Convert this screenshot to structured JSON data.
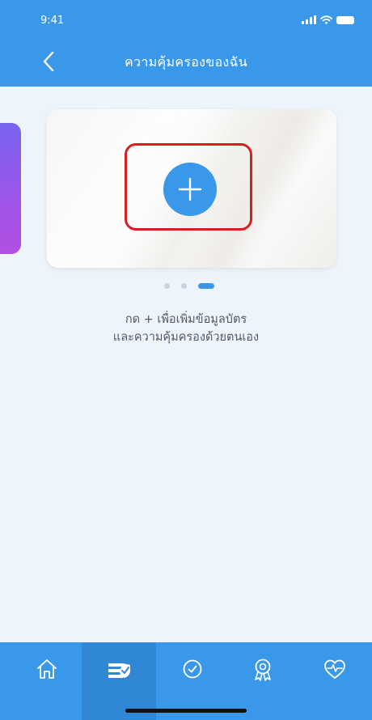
{
  "status_bar": {
    "time": "9:41",
    "icons": [
      "signal-icon",
      "wifi-icon",
      "battery-icon"
    ]
  },
  "header": {
    "title": "ความคุ้มครองของฉัน",
    "back_icon": "chevron-left-icon"
  },
  "carousel": {
    "add_icon": "plus-icon",
    "page_count": 3,
    "active_page": 3
  },
  "hint": {
    "line1": "กด + เพื่อเพิ่มข้อมูลบัตร",
    "line2": "และความคุ้มครองด้วยตนเอง"
  },
  "tabbar": {
    "items": [
      {
        "icon": "home-icon",
        "active": false
      },
      {
        "icon": "coverage-card-icon",
        "active": true
      },
      {
        "icon": "check-clock-icon",
        "active": false
      },
      {
        "icon": "award-ribbon-icon",
        "active": false
      },
      {
        "icon": "heart-pulse-icon",
        "active": false
      }
    ]
  },
  "colors": {
    "primary": "#3a98ea",
    "primary_dark": "#2f87d6",
    "background": "#eef4fc",
    "highlight": "#d62020",
    "peek_card": "#9e55e8"
  }
}
